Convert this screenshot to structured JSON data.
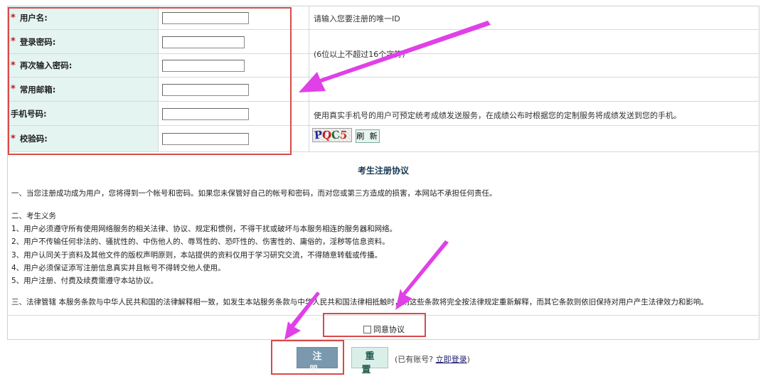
{
  "form": {
    "fields": [
      {
        "label": "用户名:",
        "required": true,
        "value": "",
        "hint": "请输入您要注册的唯一ID"
      },
      {
        "label": "登录密码:",
        "required": true,
        "value": "",
        "hint": "(6位以上不超过16个字符)"
      },
      {
        "label": "再次输入密码:",
        "required": true,
        "value": "",
        "hint": ""
      },
      {
        "label": "常用邮箱:",
        "required": true,
        "value": "",
        "hint": ""
      },
      {
        "label": "手机号码:",
        "required": false,
        "value": "",
        "hint": "使用真实手机号的用户可预定统考成绩发送服务，在成绩公布时根据您的定制服务将成绩发送到您的手机。"
      },
      {
        "label": "校验码:",
        "required": true,
        "value": "",
        "hint": ""
      }
    ],
    "required_mark": "*",
    "captcha_text": "PQC5",
    "refresh_label": "刷 新"
  },
  "agreement": {
    "title": "考生注册协议",
    "lines": [
      "一、当您注册成功成为用户，您将得到一个帐号和密码。如果您未保管好自己的帐号和密码，而对您或第三方造成的损害，本网站不承担任何责任。",
      "二、考生义务",
      "1、用户必须遵守所有使用网络服务的相关法律、协议、规定和惯例，不得干扰或破坏与本服务相连的服务器和网络。",
      "2、用户不传输任何非法的、骚扰性的、中伤他人的、辱骂性的、恐吓性的、伤害性的、庸俗的，淫秽等信息资料。",
      "3、用户认同关于资料及其他文件的版权声明原则，本站提供的资料仅用于学习研究交流，不得随意转载或传播。",
      "4、用户必须保证添写注册信息真实并且帐号不得转交他人使用。",
      "5、用户注册、付费及续费需遵守本站协议。",
      "三、法律管辖 本服务条款与中华人民共和国的法律解释相一致，如发生本站服务条款与中华人民共和国法律相抵触时，则这些条款将完全按法律规定重新解释，而其它条款则依旧保持对用户产生法律效力和影响。"
    ],
    "agree_label": "同意协议",
    "agree_checked": false
  },
  "actions": {
    "register_label": "注册",
    "reset_label": "重置",
    "account_prefix": "(已有账号?",
    "login_link": "立即登录",
    "account_suffix": ")"
  },
  "colors": {
    "label_bg": "#e4f4f1",
    "required_mark": "#c8171e",
    "highlight_box": "#d74a4a",
    "arrow": "#e040e8",
    "register_bg": "#7a98ae",
    "reset_bg": "#dbefe9"
  }
}
